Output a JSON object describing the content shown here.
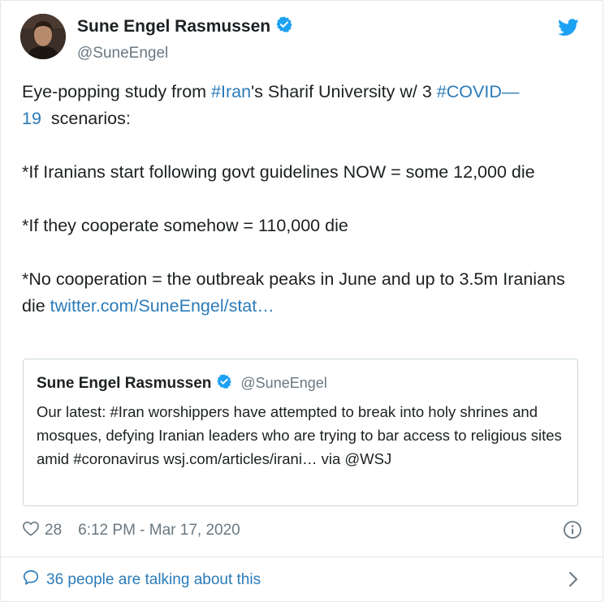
{
  "tweet": {
    "author_name": "Sune Engel Rasmussen",
    "author_handle": "@SuneEngel",
    "body": {
      "p1_a": "Eye-popping study from ",
      "p1_tag1": "#Iran",
      "p1_b": "'s Sharif University w/ 3 ",
      "p1_tag2a": "#COVID—",
      "p1_tag2b": "19",
      "p1_c": "  scenarios:",
      "p2": "*If Iranians start following govt guidelines NOW = some 12,000 die",
      "p3": "*If they cooperate somehow = 110,000 die",
      "p4": "*No cooperation = the outbreak peaks in June and up to 3.5m Iranians die ",
      "p4_link": "twitter.com/SuneEngel/stat…"
    },
    "likes": "28",
    "timestamp": "6:12 PM - Mar 17, 2020"
  },
  "quoted": {
    "author_name": "Sune Engel Rasmussen",
    "author_handle": "@SuneEngel",
    "text": "Our latest: #Iran worshippers have attempted to break into holy shrines and mosques, defying Iranian leaders who are trying to bar access to religious sites amid #coronavirus wsj.com/articles/irani… via @WSJ"
  },
  "footer": {
    "talking_label": "36 people are talking about this"
  },
  "colors": {
    "twitter_blue": "#1da1f2",
    "link": "#2b7bb9",
    "muted": "#697882",
    "text": "#1c2022"
  },
  "icons": [
    "verified-badge-icon",
    "twitter-bird-icon",
    "heart-icon",
    "info-icon",
    "speech-bubble-icon",
    "chevron-right-icon"
  ]
}
